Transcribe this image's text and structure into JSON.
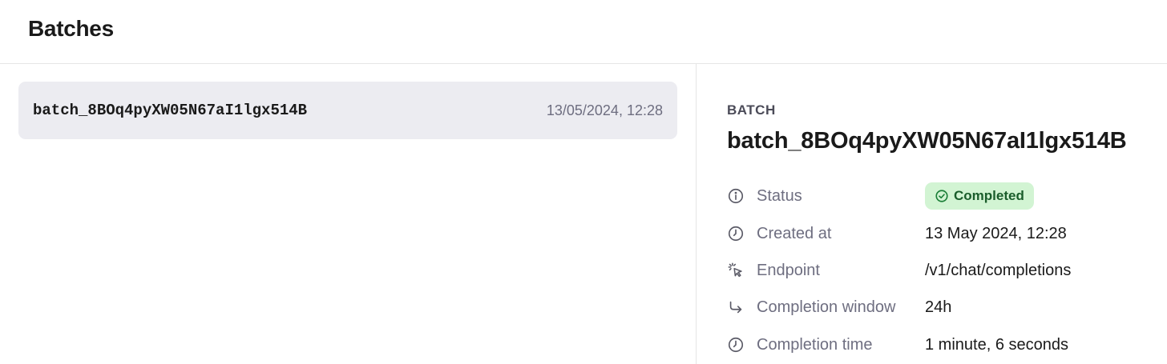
{
  "header": {
    "title": "Batches"
  },
  "batch_list": [
    {
      "id": "batch_8BOq4pyXW05N67aI1lgx514B",
      "date": "13/05/2024, 12:28"
    }
  ],
  "detail": {
    "kicker": "BATCH",
    "title": "batch_8BOq4pyXW05N67aI1lgx514B",
    "status": {
      "label": "Status",
      "value": "Completed",
      "icon": "info-icon"
    },
    "created_at": {
      "label": "Created at",
      "value": "13 May 2024, 12:28",
      "icon": "clock-icon"
    },
    "endpoint": {
      "label": "Endpoint",
      "value": "/v1/chat/completions",
      "icon": "cursor-click-icon"
    },
    "completion_window": {
      "label": "Completion window",
      "value": "24h",
      "icon": "arrow-return-icon"
    },
    "completion_time": {
      "label": "Completion time",
      "value": "1 minute, 6 seconds",
      "icon": "clock-icon"
    }
  },
  "colors": {
    "row_background": "#ececf1",
    "status_badge_background": "#d2f4d3",
    "status_badge_text": "#1a5d2b",
    "muted_text": "#6e6e80"
  }
}
